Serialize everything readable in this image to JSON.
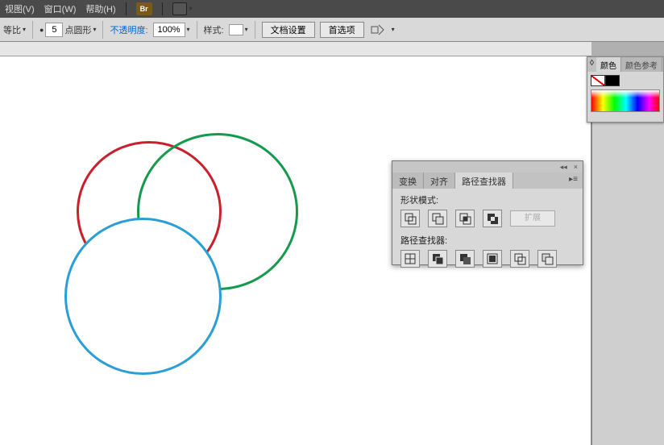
{
  "menubar": {
    "items": [
      "视图(V)",
      "窗口(W)",
      "帮助(H)"
    ],
    "br_icon": "Br"
  },
  "optionsbar": {
    "scale_label": "等比",
    "stroke_value": "5",
    "stroke_style_label": "点圆形",
    "opacity_label": "不透明度:",
    "opacity_value": "100%",
    "style_label": "样式:",
    "doc_setup": "文档设置",
    "prefs": "首选项"
  },
  "colorpanel": {
    "tab_color": "颜色",
    "tab_ref": "颜色参考",
    "expand_icon": "◊"
  },
  "pathpanel": {
    "tabs": [
      "变换",
      "对齐",
      "路径查找器"
    ],
    "active_tab": 2,
    "section1": "形状模式:",
    "section2": "路径查找器:",
    "expand_label": "扩展",
    "collapse_icon": "◂◂",
    "close_icon": "×",
    "menu_icon": "▸≡"
  },
  "canvas": {
    "circles": [
      {
        "name": "red-circle",
        "color": "#c9202e"
      },
      {
        "name": "green-circle",
        "color": "#159a4d"
      },
      {
        "name": "blue-circle",
        "color": "#2a9fd6"
      }
    ]
  }
}
